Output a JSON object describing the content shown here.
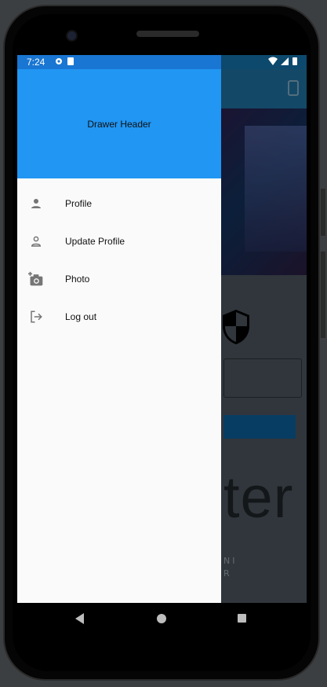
{
  "status_bar": {
    "time": "7:24"
  },
  "drawer": {
    "header_title": "Drawer Header",
    "items": [
      {
        "label": "Profile",
        "icon": "person-icon"
      },
      {
        "label": "Update Profile",
        "icon": "person-outline-icon"
      },
      {
        "label": "Photo",
        "icon": "add-a-photo-icon"
      },
      {
        "label": "Log out",
        "icon": "logout-icon"
      }
    ]
  },
  "background_page": {
    "big_text": "ter",
    "small_text_line1": "NI",
    "small_text_line2": "R"
  },
  "colors": {
    "drawer_header": "#2196f3",
    "drawer_status": "#1976d2",
    "drawer_background": "#fafafa",
    "app_bar": "#1f6f9e"
  }
}
